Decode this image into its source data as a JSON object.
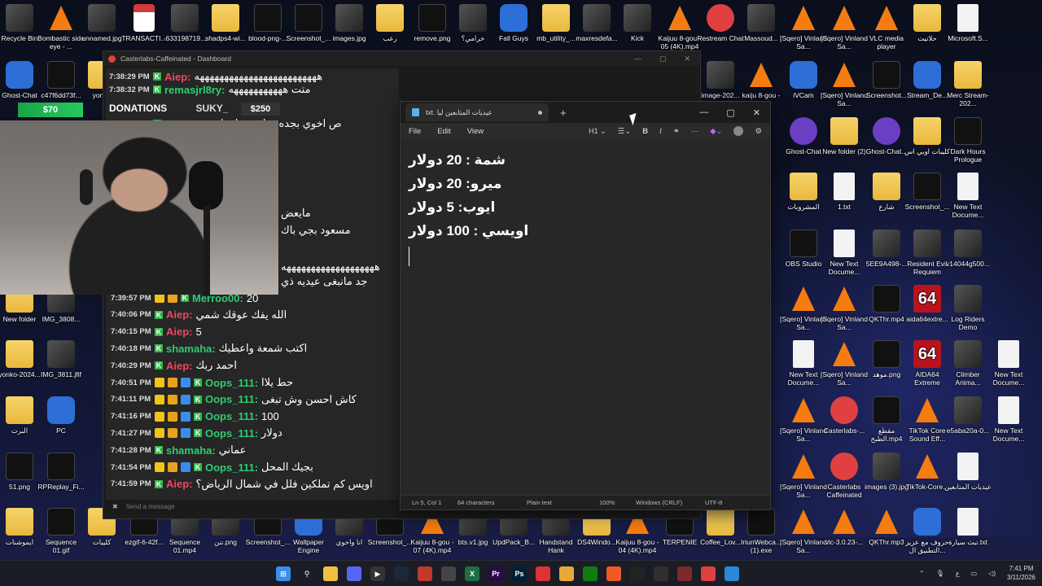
{
  "desktop": {
    "icons": [
      {
        "label": "Recycle Bin",
        "kind": "img"
      },
      {
        "label": "Bombastic side eye - ...",
        "kind": "vlc"
      },
      {
        "label": "unnamed.jpg",
        "kind": "img"
      },
      {
        "label": "TRANSACTI...",
        "kind": "pdf"
      },
      {
        "label": "-633198719...",
        "kind": "img"
      },
      {
        "label": "shadps4-wi...",
        "kind": "folder"
      },
      {
        "label": "blood-png-...",
        "kind": "black"
      },
      {
        "label": "Screenshot_...",
        "kind": "black"
      },
      {
        "label": "images.jpg",
        "kind": "img"
      },
      {
        "label": "رعب",
        "kind": "folder"
      },
      {
        "label": "remove.png",
        "kind": "black"
      },
      {
        "label": "خرامي؟",
        "kind": "img"
      },
      {
        "label": "Fall Guys",
        "kind": "app"
      },
      {
        "label": "mb_utility_...",
        "kind": "folder"
      },
      {
        "label": "maxresdefa...",
        "kind": "img"
      },
      {
        "label": "Kick",
        "kind": "img"
      },
      {
        "label": "Kaijuu 8-gou - 05 (4K).mp4",
        "kind": "vlc"
      },
      {
        "label": "Restream Chat",
        "kind": "red"
      },
      {
        "label": "Massoud...",
        "kind": "img"
      },
      {
        "label": "[Sqero] Vinland Sa...",
        "kind": "vlc"
      },
      {
        "label": "[Sqero] Vinland Sa...",
        "kind": "vlc"
      },
      {
        "label": "VLC media player",
        "kind": "vlc"
      },
      {
        "label": "حلاتيت",
        "kind": "folder"
      },
      {
        "label": "Microsoft.S...",
        "kind": "file"
      },
      {
        "label": "Ghost-Chat",
        "kind": "app"
      },
      {
        "label": "c47f6dd73f...",
        "kind": "black"
      },
      {
        "label": "yonko",
        "kind": "folder"
      },
      {
        "label": "image-202...",
        "kind": "img"
      },
      {
        "label": "kaiju 8-gou - 05",
        "kind": "vlc"
      },
      {
        "label": "iVCam",
        "kind": "app"
      },
      {
        "label": "[Sqero] Vinland Sa...",
        "kind": "vlc"
      },
      {
        "label": "Screenshot...",
        "kind": "black"
      },
      {
        "label": "Stream_De...",
        "kind": "app"
      },
      {
        "label": "Merc Stream-202...",
        "kind": "folder"
      },
      {
        "label": "Ghost-Chat",
        "kind": "purple"
      },
      {
        "label": "New folder (2)",
        "kind": "folder"
      },
      {
        "label": "Ghost-Chat...",
        "kind": "purple"
      },
      {
        "label": "كليبات اوبي اس",
        "kind": "folder"
      },
      {
        "label": "Dark Hours Prologue",
        "kind": "black"
      },
      {
        "label": "المشروبات",
        "kind": "folder"
      },
      {
        "label": "1.txt",
        "kind": "file"
      },
      {
        "label": "شارع",
        "kind": "folder"
      },
      {
        "label": "Screenshot_...",
        "kind": "black"
      },
      {
        "label": "New Text Docume...",
        "kind": "file"
      },
      {
        "label": "OBS Studio",
        "kind": "black"
      },
      {
        "label": "New Text Docume...",
        "kind": "file"
      },
      {
        "label": "5EE9A498-...",
        "kind": "img"
      },
      {
        "label": "Resident Evil Requiem",
        "kind": "img"
      },
      {
        "label": "v14044g500...",
        "kind": "img"
      },
      {
        "label": "New folder",
        "kind": "folder"
      },
      {
        "label": "IMG_3808...",
        "kind": "img"
      },
      {
        "label": "[Sqero] Vinland Sa...",
        "kind": "vlc"
      },
      {
        "label": "[Sqero] Vinland Sa...",
        "kind": "vlc"
      },
      {
        "label": "QKThr.mp4",
        "kind": "black"
      },
      {
        "label": "aida64extre...",
        "kind": "aida"
      },
      {
        "label": "Log Riders Demo",
        "kind": "img"
      },
      {
        "label": "yonko-2024...",
        "kind": "folder"
      },
      {
        "label": "IMG_3811.jfif",
        "kind": "img"
      },
      {
        "label": "New Text Docume...",
        "kind": "file"
      },
      {
        "label": "[Sqero] Vinland Sa...",
        "kind": "vlc"
      },
      {
        "label": "موهد.png",
        "kind": "black"
      },
      {
        "label": "AIDA64 Extreme",
        "kind": "aida"
      },
      {
        "label": "Climber Anima...",
        "kind": "img"
      },
      {
        "label": "New Text Docume...",
        "kind": "file"
      },
      {
        "label": "البرت",
        "kind": "folder"
      },
      {
        "label": "PC",
        "kind": "app"
      },
      {
        "label": "[Sqero] Vinland Sa...",
        "kind": "vlc"
      },
      {
        "label": "Casterlabs-...",
        "kind": "red"
      },
      {
        "label": "مقطع الطبخ.mp4",
        "kind": "black"
      },
      {
        "label": "TikTok Core Sound Eff...",
        "kind": "vlc"
      },
      {
        "label": "e5aba20a-0...",
        "kind": "img"
      },
      {
        "label": "New Text Docume...",
        "kind": "file"
      },
      {
        "label": "51.png",
        "kind": "black"
      },
      {
        "label": "RPReplay_Fi...",
        "kind": "black"
      },
      {
        "label": "[Sqero] Vinland Sa...",
        "kind": "vlc"
      },
      {
        "label": "Casterlabs Caffeinated",
        "kind": "red"
      },
      {
        "label": "images (3).jpg",
        "kind": "img"
      },
      {
        "label": "TikTok-Core...",
        "kind": "vlc"
      },
      {
        "label": "عيديات المتابعين",
        "kind": "file"
      },
      {
        "label": "ايموشنات",
        "kind": "folder"
      },
      {
        "label": "Sequence 01.gif",
        "kind": "black"
      },
      {
        "label": "كليبات",
        "kind": "folder"
      },
      {
        "label": "ezgif-6-42f...",
        "kind": "black"
      },
      {
        "label": "Sequence 01.mp4",
        "kind": "img"
      },
      {
        "label": "تنن.png",
        "kind": "img"
      },
      {
        "label": "Screenshot_...",
        "kind": "black"
      },
      {
        "label": "Wallpaper Engine",
        "kind": "app"
      },
      {
        "label": "انا واخوي",
        "kind": "img"
      },
      {
        "label": "Screenshot_...",
        "kind": "black"
      },
      {
        "label": "Kaijuu 8-gou - 07 (4K).mp4",
        "kind": "vlc"
      },
      {
        "label": "bts.v1.jpg",
        "kind": "img"
      },
      {
        "label": "UpdPack_B...",
        "kind": "img"
      },
      {
        "label": "Handstand Hank",
        "kind": "img"
      },
      {
        "label": "DS4Windo...",
        "kind": "folder"
      },
      {
        "label": "Kaijuu 8-gou - 04 (4K).mp4",
        "kind": "vlc"
      },
      {
        "label": "TERPENIE",
        "kind": "black"
      },
      {
        "label": "Coffee_Lov...",
        "kind": "folder"
      },
      {
        "label": "IriunWebca... (1).exe",
        "kind": "black"
      },
      {
        "label": "[Sqero] Vinland Sa...",
        "kind": "vlc"
      },
      {
        "label": "vlc-3.0.23-...",
        "kind": "vlc"
      },
      {
        "label": "QKThr.mp3",
        "kind": "vlc"
      },
      {
        "label": "حروف مع عزيز التطبيق ال...",
        "kind": "app"
      },
      {
        "label": "تبث سيارة.txt",
        "kind": "file"
      }
    ]
  },
  "caster": {
    "title": "Casterlabs-Caffeinated - Dashboard",
    "donations_label": "DONATIONS",
    "donation_left": "$70",
    "donation_right": "$250",
    "donation_user": "SUKY_",
    "input_placeholder": "Send a message"
  },
  "chat": {
    "top_lines": [
      {
        "time": "7:38:29 PM",
        "user": "Aiep",
        "color": "#e84a5f",
        "msg": "هههههههههههههههههههههههههه"
      },
      {
        "time": "7:38:32 PM",
        "user": "remasjrl8ry",
        "color": "#2ecc71",
        "msg": "متت هههههههههههه"
      },
      {
        "time": "7:38:38 PM",
        "user": "Oops_111",
        "color": "#2ecc71",
        "msg": "ص اخوي بجده بخليه يسلمها"
      }
    ],
    "side_lines": [
      {
        "text": "مايعض"
      },
      {
        "text": "مسعود بجي باك"
      },
      {
        "text": "هههههههههههههههههههه"
      },
      {
        "text": "جد مانبغى عيديه ذي"
      }
    ],
    "lines": [
      {
        "time": "7:39:57 PM",
        "user": "Merroo00",
        "color": "#2ecc71",
        "msg": "20",
        "badges": "vb"
      },
      {
        "time": "7:40:06 PM",
        "user": "Aiep",
        "color": "#e84a5f",
        "msg": "الله يفك عوقك شمي",
        "badges": ""
      },
      {
        "time": "7:40:15 PM",
        "user": "Aiep",
        "color": "#e84a5f",
        "msg": "5",
        "badges": ""
      },
      {
        "time": "7:40:18 PM",
        "user": "shamaha",
        "color": "#2ecc71",
        "msg": "اكتب شمعة واعطيك",
        "badges": ""
      },
      {
        "time": "7:40:29 PM",
        "user": "Aiep",
        "color": "#e84a5f",
        "msg": "احمد ربك",
        "badges": ""
      },
      {
        "time": "7:40:51 PM",
        "user": "Oops_111",
        "color": "#2ecc71",
        "msg": "حط يلاا",
        "badges": "vbs"
      },
      {
        "time": "7:41:11 PM",
        "user": "Oops_111",
        "color": "#2ecc71",
        "msg": "كاش احسن وش تبغى",
        "badges": "vbs"
      },
      {
        "time": "7:41:16 PM",
        "user": "Oops_111",
        "color": "#2ecc71",
        "msg": "100",
        "badges": "vbs"
      },
      {
        "time": "7:41:27 PM",
        "user": "Oops_111",
        "color": "#2ecc71",
        "msg": "دولار",
        "badges": "vbs"
      },
      {
        "time": "7:41:28 PM",
        "user": "shamaha",
        "color": "#2ecc71",
        "msg": "عماني",
        "badges": ""
      },
      {
        "time": "7:41:54 PM",
        "user": "Oops_111",
        "color": "#2ecc71",
        "msg": "بجيك المحل",
        "badges": "vbs"
      },
      {
        "time": "7:41:59 PM",
        "user": "Aiep",
        "color": "#e84a5f",
        "msg": "اويس كم تملكين فلل في شمال الرياض؟",
        "badges": ""
      }
    ]
  },
  "notepad": {
    "tab_title": "عيديات المتابعين ليا .txt",
    "menu": [
      "File",
      "Edit",
      "View"
    ],
    "heading_tool": "H1",
    "lines": [
      "شمة : 20 دولار",
      "ميرو: 20 دولار",
      "ايوب: 5 دولار",
      "اويسي : 100 دولار"
    ],
    "status": {
      "position": "Ln 5, Col 1",
      "chars": "64 characters",
      "format": "Plain text",
      "zoom": "100%",
      "line_ending": "Windows (CRLF)",
      "encoding": "UTF-8"
    }
  },
  "taskbar": {
    "time": "7:41 PM",
    "date": "3/11/2026",
    "lang": "ع",
    "apps": [
      {
        "name": "start-icon",
        "color": "#3b8eea",
        "glyph": "⊞"
      },
      {
        "name": "search-icon",
        "color": "transparent",
        "glyph": "⚲"
      },
      {
        "name": "explorer-icon",
        "color": "#f0c040",
        "glyph": ""
      },
      {
        "name": "discord-icon",
        "color": "#5865f2",
        "glyph": ""
      },
      {
        "name": "media-icon",
        "color": "#333",
        "glyph": "▶"
      },
      {
        "name": "steam-icon",
        "color": "#1b2838",
        "glyph": ""
      },
      {
        "name": "app-red-icon",
        "color": "#c0392b",
        "glyph": ""
      },
      {
        "name": "app-dark-icon",
        "color": "#444",
        "glyph": ""
      },
      {
        "name": "excel-icon",
        "color": "#1d6f42",
        "glyph": "X"
      },
      {
        "name": "premiere-icon",
        "color": "#2a0a4a",
        "glyph": "Pr"
      },
      {
        "name": "photoshop-icon",
        "color": "#001e36",
        "glyph": "Ps"
      },
      {
        "name": "acrobat-icon",
        "color": "#d33",
        "glyph": ""
      },
      {
        "name": "chrome-icon",
        "color": "#e8a93a",
        "glyph": ""
      },
      {
        "name": "xbox-icon",
        "color": "#107c10",
        "glyph": ""
      },
      {
        "name": "brave-icon",
        "color": "#f05a24",
        "glyph": ""
      },
      {
        "name": "capcut-icon",
        "color": "#222",
        "glyph": ""
      },
      {
        "name": "obs-icon",
        "color": "#302e31",
        "glyph": ""
      },
      {
        "name": "game-icon",
        "color": "#7a2a2a",
        "glyph": ""
      },
      {
        "name": "casterlabs-icon",
        "color": "#e04040",
        "glyph": ""
      },
      {
        "name": "notepad-icon",
        "color": "#2b88d8",
        "glyph": ""
      }
    ]
  }
}
